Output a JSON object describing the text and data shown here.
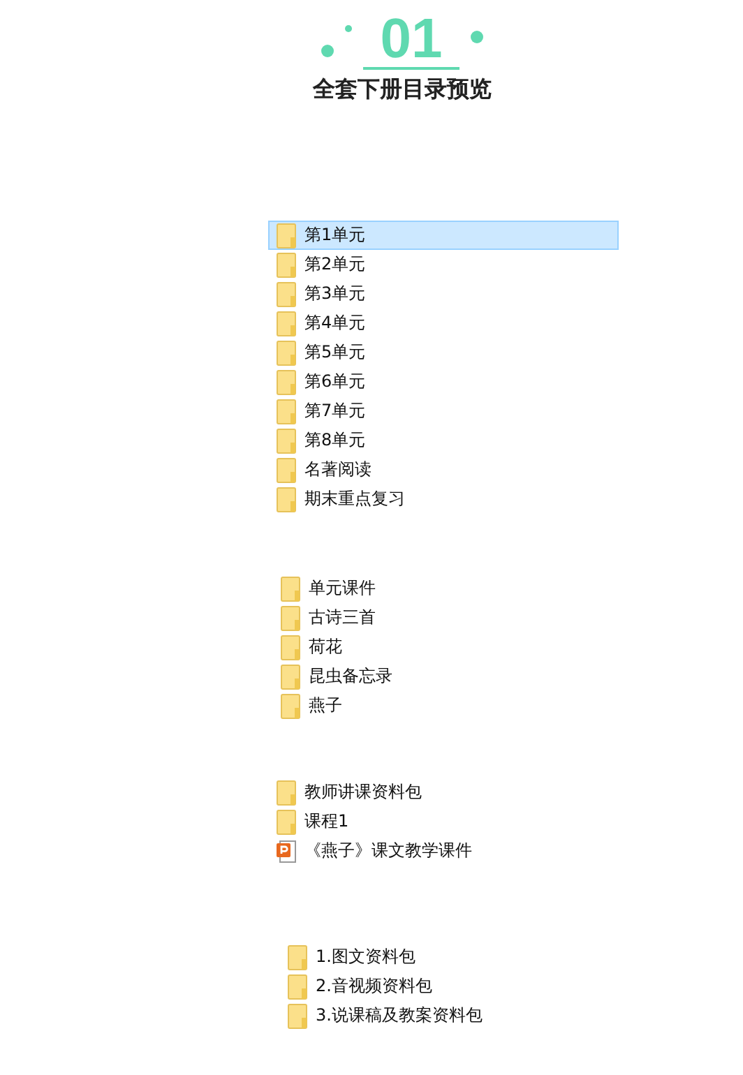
{
  "header": {
    "number": "01",
    "title": "全套下册目录预览"
  },
  "groups": [
    {
      "items": [
        {
          "kind": "folder",
          "name": "第1单元",
          "selected": true
        },
        {
          "kind": "folder",
          "name": "第2单元",
          "selected": false
        },
        {
          "kind": "folder",
          "name": "第3单元",
          "selected": false
        },
        {
          "kind": "folder",
          "name": "第4单元",
          "selected": false
        },
        {
          "kind": "folder",
          "name": "第5单元",
          "selected": false
        },
        {
          "kind": "folder",
          "name": "第6单元",
          "selected": false
        },
        {
          "kind": "folder",
          "name": "第7单元",
          "selected": false
        },
        {
          "kind": "folder",
          "name": "第8单元",
          "selected": false
        },
        {
          "kind": "folder",
          "name": "名著阅读",
          "selected": false
        },
        {
          "kind": "folder",
          "name": "期末重点复习",
          "selected": false
        }
      ]
    },
    {
      "items": [
        {
          "kind": "folder",
          "name": "单元课件",
          "selected": false
        },
        {
          "kind": "folder",
          "name": "古诗三首",
          "selected": false
        },
        {
          "kind": "folder",
          "name": "荷花",
          "selected": false
        },
        {
          "kind": "folder",
          "name": "昆虫备忘录",
          "selected": false
        },
        {
          "kind": "folder",
          "name": "燕子",
          "selected": false
        }
      ]
    },
    {
      "items": [
        {
          "kind": "folder",
          "name": "教师讲课资料包",
          "selected": false
        },
        {
          "kind": "folder",
          "name": "课程1",
          "selected": false
        },
        {
          "kind": "slides",
          "name": "《燕子》课文教学课件",
          "selected": false
        }
      ]
    },
    {
      "items": [
        {
          "kind": "folder",
          "name": "1.图文资料包",
          "selected": false
        },
        {
          "kind": "folder",
          "name": "2.音视频资料包",
          "selected": false
        },
        {
          "kind": "folder",
          "name": "3.说课稿及教案资料包",
          "selected": false
        }
      ]
    }
  ]
}
